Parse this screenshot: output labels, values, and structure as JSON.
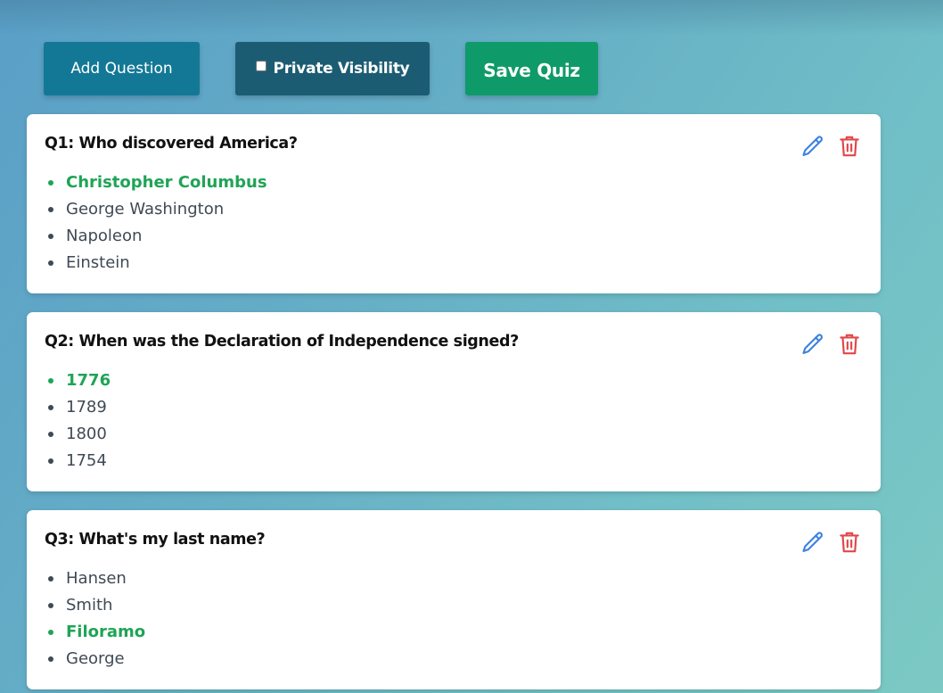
{
  "toolbar": {
    "add_question_label": "Add Question",
    "private_visibility_label": "Private Visibility",
    "private_visibility_checked": false,
    "save_quiz_label": "Save Quiz"
  },
  "colors": {
    "correct_answer": "#1fa456",
    "edit_icon": "#3b82e0",
    "delete_icon": "#e0474a",
    "add_button": "#137895",
    "private_button": "#1c5c73",
    "save_button": "#0f9a6a"
  },
  "questions": [
    {
      "title": "Q1: Who discovered America?",
      "answers": [
        {
          "text": "Christopher Columbus",
          "correct": true
        },
        {
          "text": "George Washington",
          "correct": false
        },
        {
          "text": "Napoleon",
          "correct": false
        },
        {
          "text": "Einstein",
          "correct": false
        }
      ],
      "icons": [
        "pencil-icon",
        "trash-icon"
      ]
    },
    {
      "title": "Q2: When was the Declaration of Independence signed?",
      "answers": [
        {
          "text": "1776",
          "correct": true
        },
        {
          "text": "1789",
          "correct": false
        },
        {
          "text": "1800",
          "correct": false
        },
        {
          "text": "1754",
          "correct": false
        }
      ],
      "icons": [
        "pencil-icon",
        "trash-icon"
      ]
    },
    {
      "title": "Q3: What's my last name?",
      "answers": [
        {
          "text": "Hansen",
          "correct": false
        },
        {
          "text": "Smith",
          "correct": false
        },
        {
          "text": "Filoramo",
          "correct": true
        },
        {
          "text": "George",
          "correct": false
        }
      ],
      "icons": [
        "pencil-icon",
        "trash-icon"
      ]
    }
  ]
}
